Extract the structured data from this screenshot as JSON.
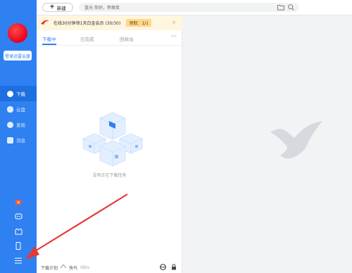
{
  "sidebar": {
    "login_label": "登录迅雷云盘",
    "items": [
      {
        "label": "下载",
        "icon": "download-icon",
        "active": true
      },
      {
        "label": "云盘",
        "icon": "cloud-icon",
        "active": false
      },
      {
        "label": "发现",
        "icon": "discover-icon",
        "active": false
      },
      {
        "label": "消息",
        "icon": "message-icon",
        "active": false
      }
    ],
    "bottom_icons": [
      "gift-icon",
      "game-icon",
      "vip-icon",
      "phone-icon",
      "menu-icon"
    ]
  },
  "topbar": {
    "new_label": "新建",
    "search_text": "蓝光  你好，李焕英"
  },
  "promo": {
    "text": "在线30分钟领1天白金会员 (30/30)",
    "button_label": "领取：1/1",
    "close": "×"
  },
  "tabs": [
    {
      "label": "下载中",
      "active": true
    },
    {
      "label": "已完成",
      "active": false
    },
    {
      "label": "回收站",
      "active": false
    }
  ],
  "more_label": "···",
  "empty_text": "没有正在下载任务",
  "footer": {
    "plan_label": "下载计划",
    "mode_label": "快鸟",
    "speed": "0B/s"
  },
  "colors": {
    "brand": "#2f80f0",
    "promo_bg": "#fff6e0",
    "annotation": "#e53935"
  }
}
